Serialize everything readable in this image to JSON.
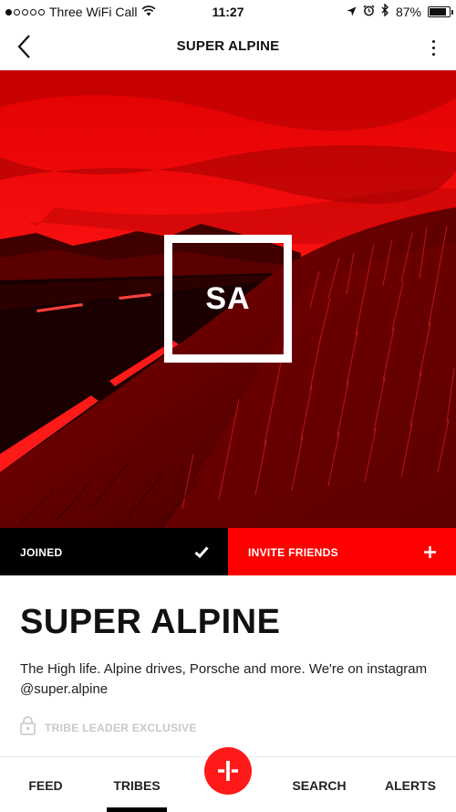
{
  "status_bar": {
    "carrier": "Three WiFi Call",
    "time": "11:27",
    "battery": "87%",
    "battery_level": 0.87,
    "signal_dots_filled": 1,
    "icons": [
      "wifi-icon",
      "location-arrow-icon",
      "alarm-icon",
      "bluetooth-icon",
      "battery-icon"
    ]
  },
  "header": {
    "title": "SUPER ALPINE",
    "back_icon": "chevron-left-icon",
    "menu_icon": "vertical-ellipsis-icon"
  },
  "hero": {
    "logo_text": "SA",
    "tint_color": "#ff0000"
  },
  "actions": {
    "joined_label": "JOINED",
    "joined_icon": "checkmark-icon",
    "invite_label": "INVITE FRIENDS",
    "invite_icon": "plus-icon"
  },
  "tribe": {
    "name": "SUPER ALPINE",
    "description": "The High life. Alpine drives, Porsche and more. We're on instagram @super.alpine",
    "exclusive_label": "TRIBE LEADER EXCLUSIVE",
    "exclusive_icon": "lock-icon"
  },
  "tabs": {
    "feed": "FEED",
    "tribes": "TRIBES",
    "search": "SEARCH",
    "alerts": "ALERTS",
    "active": "tribes",
    "fab_icon": "add-icon"
  },
  "colors": {
    "brand_red": "#ff0000",
    "joined_bg": "#000000",
    "muted_text": "#c8c8c8"
  }
}
